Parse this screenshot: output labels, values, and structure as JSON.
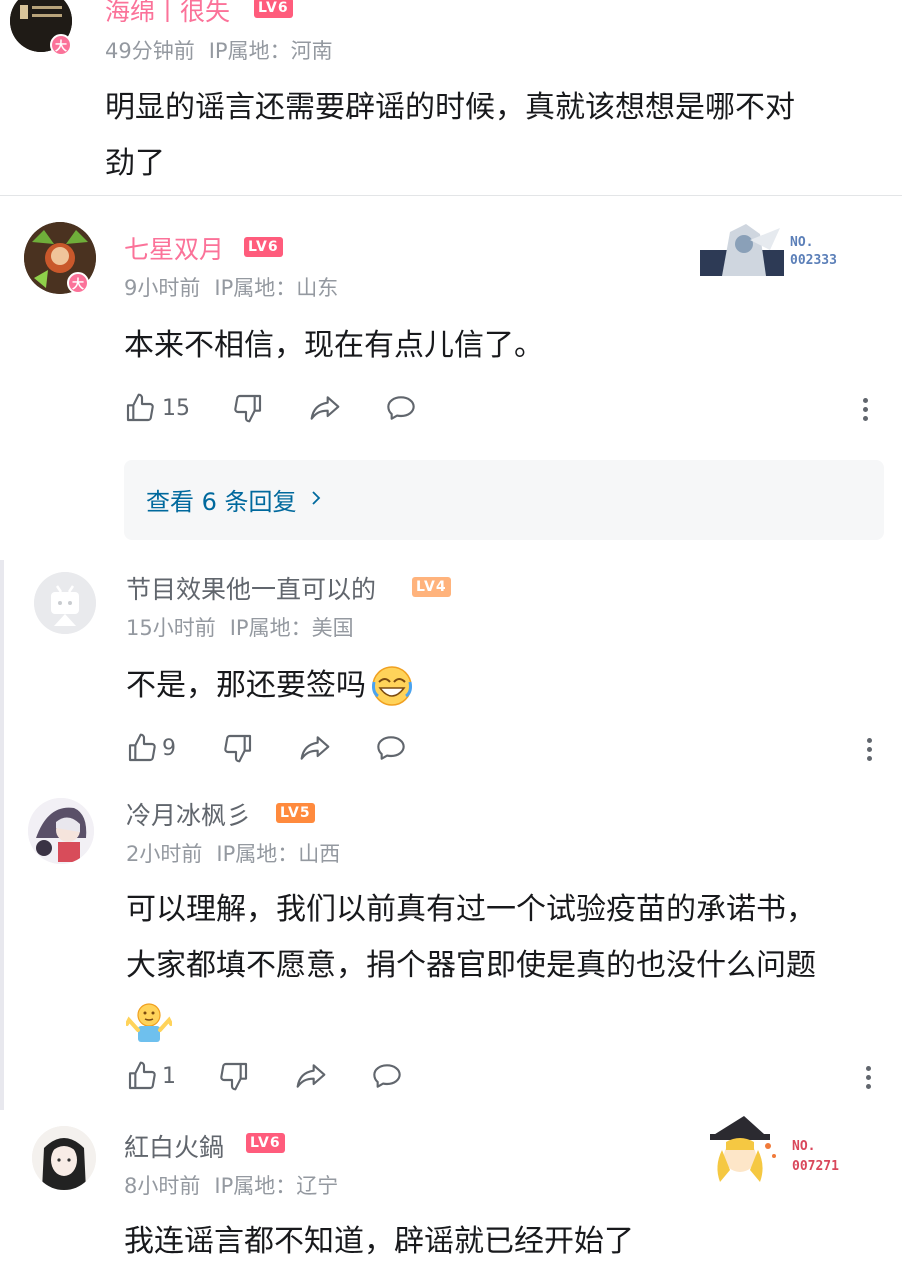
{
  "comments": [
    {
      "username": "海绵丨很失",
      "level": "LV6",
      "time": "49分钟前",
      "ip": "IP属地：河南",
      "content_line1": "明显的谣言还需要辟谣的时候，真就该想想是哪不对",
      "content_line2": "劲了",
      "vip_badge": "大"
    },
    {
      "username": "七星双月",
      "level": "LV6",
      "time": "9小时前",
      "ip": "IP属地：山东",
      "content": "本来不相信，现在有点儿信了。",
      "likes": "15",
      "view_replies": "查看 6 条回复",
      "fan_no_label": "NO.",
      "fan_no": "002333",
      "vip_badge": "大"
    },
    {
      "username": "节目效果他一直可以的",
      "level": "LV4",
      "time": "15小时前",
      "ip": "IP属地：美国",
      "content": "不是，那还要签吗",
      "likes": "9"
    },
    {
      "username": "冷月冰枫彡",
      "level": "LV5",
      "time": "2小时前",
      "ip": "IP属地：山西",
      "content_line1": "可以理解，我们以前真有过一个试验疫苗的承诺书，",
      "content_line2": "大家都填不愿意，捐个器官即使是真的也没什么问题",
      "likes": "1"
    },
    {
      "username": "紅白火鍋",
      "level": "LV6",
      "time": "8小时前",
      "ip": "IP属地：辽宁",
      "content": "我连谣言都不知道，辟谣就已经开始了",
      "fan_no_label": "NO.",
      "fan_no": "007271"
    }
  ],
  "colors": {
    "vip_name": "#fb7299",
    "lv6": "#ff5c7c",
    "lv5": "#ff8a3d",
    "lv4": "#ffb37c",
    "reply_link": "#00699d"
  },
  "icons": [
    "thumbs-up-icon",
    "thumbs-down-icon",
    "share-icon",
    "reply-bubble-icon",
    "more-vertical-icon",
    "chevron-right-icon"
  ]
}
